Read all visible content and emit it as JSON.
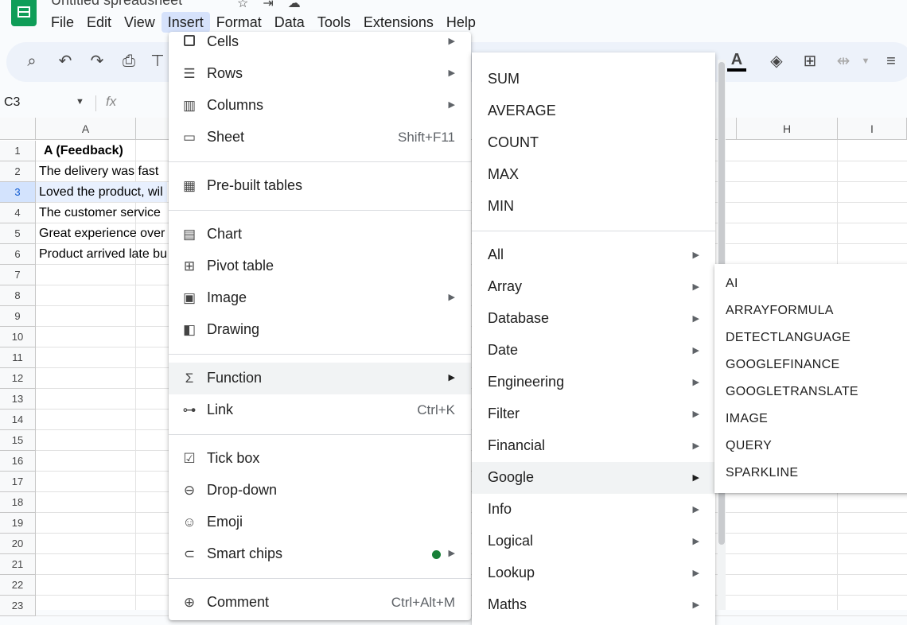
{
  "app": {
    "title": "Untitled spreadsheet"
  },
  "menubar": [
    "File",
    "Edit",
    "View",
    "Insert",
    "Format",
    "Data",
    "Tools",
    "Extensions",
    "Help"
  ],
  "namebox": {
    "value": "C3"
  },
  "formula_bar": {
    "fx_label": "fx",
    "value": ""
  },
  "columns": [
    "A",
    "H",
    "I"
  ],
  "rows": [
    {
      "num": "1",
      "a": "A (Feedback)"
    },
    {
      "num": "2",
      "a": "The delivery was fast"
    },
    {
      "num": "3",
      "a": "Loved the product, wil"
    },
    {
      "num": "4",
      "a": "The customer service"
    },
    {
      "num": "5",
      "a": "Great experience over"
    },
    {
      "num": "6",
      "a": "Product arrived late bu"
    },
    {
      "num": "7",
      "a": ""
    },
    {
      "num": "8",
      "a": ""
    },
    {
      "num": "9",
      "a": ""
    },
    {
      "num": "10",
      "a": ""
    },
    {
      "num": "11",
      "a": ""
    },
    {
      "num": "12",
      "a": ""
    },
    {
      "num": "13",
      "a": ""
    },
    {
      "num": "14",
      "a": ""
    },
    {
      "num": "15",
      "a": ""
    },
    {
      "num": "16",
      "a": ""
    },
    {
      "num": "17",
      "a": ""
    },
    {
      "num": "18",
      "a": ""
    },
    {
      "num": "19",
      "a": ""
    },
    {
      "num": "20",
      "a": ""
    },
    {
      "num": "21",
      "a": ""
    },
    {
      "num": "22",
      "a": ""
    },
    {
      "num": "23",
      "a": ""
    }
  ],
  "insert_menu": {
    "items": [
      {
        "label": "Cells",
        "shortcut": "",
        "submenu": true,
        "icon": "cells-icon"
      },
      {
        "label": "Rows",
        "shortcut": "",
        "submenu": true,
        "icon": "rows-icon"
      },
      {
        "label": "Columns",
        "shortcut": "",
        "submenu": true,
        "icon": "columns-icon"
      },
      {
        "label": "Sheet",
        "shortcut": "Shift+F11",
        "submenu": false,
        "icon": "sheet-icon"
      },
      {
        "label": "Pre-built tables",
        "shortcut": "",
        "submenu": false,
        "icon": "table-icon"
      },
      {
        "label": "Chart",
        "shortcut": "",
        "submenu": false,
        "icon": "chart-icon"
      },
      {
        "label": "Pivot table",
        "shortcut": "",
        "submenu": false,
        "icon": "pivot-table-icon"
      },
      {
        "label": "Image",
        "shortcut": "",
        "submenu": true,
        "icon": "image-icon"
      },
      {
        "label": "Drawing",
        "shortcut": "",
        "submenu": false,
        "icon": "drawing-icon"
      },
      {
        "label": "Function",
        "shortcut": "",
        "submenu": true,
        "icon": "sigma-icon"
      },
      {
        "label": "Link",
        "shortcut": "Ctrl+K",
        "submenu": false,
        "icon": "link-icon"
      },
      {
        "label": "Tick box",
        "shortcut": "",
        "submenu": false,
        "icon": "checkbox-icon"
      },
      {
        "label": "Drop-down",
        "shortcut": "",
        "submenu": false,
        "icon": "dropdown-icon"
      },
      {
        "label": "Emoji",
        "shortcut": "",
        "submenu": false,
        "icon": "emoji-icon"
      },
      {
        "label": "Smart chips",
        "shortcut": "",
        "submenu": true,
        "icon": "smart-chips-icon"
      },
      {
        "label": "Comment",
        "shortcut": "Ctrl+Alt+M",
        "submenu": false,
        "icon": "comment-icon"
      }
    ]
  },
  "function_menu": {
    "quick": [
      "SUM",
      "AVERAGE",
      "COUNT",
      "MAX",
      "MIN"
    ],
    "categories": [
      "All",
      "Array",
      "Database",
      "Date",
      "Engineering",
      "Filter",
      "Financial",
      "Google",
      "Info",
      "Logical",
      "Lookup",
      "Maths"
    ]
  },
  "google_menu": {
    "items": [
      "AI",
      "ARRAYFORMULA",
      "DETECTLANGUAGE",
      "GOOGLEFINANCE",
      "GOOGLETRANSLATE",
      "IMAGE",
      "QUERY",
      "SPARKLINE"
    ]
  },
  "colors": {
    "accent": "#0b57d0",
    "selection": "#d3e3fd",
    "logo": "#0f9d58",
    "badge": "#188038"
  }
}
